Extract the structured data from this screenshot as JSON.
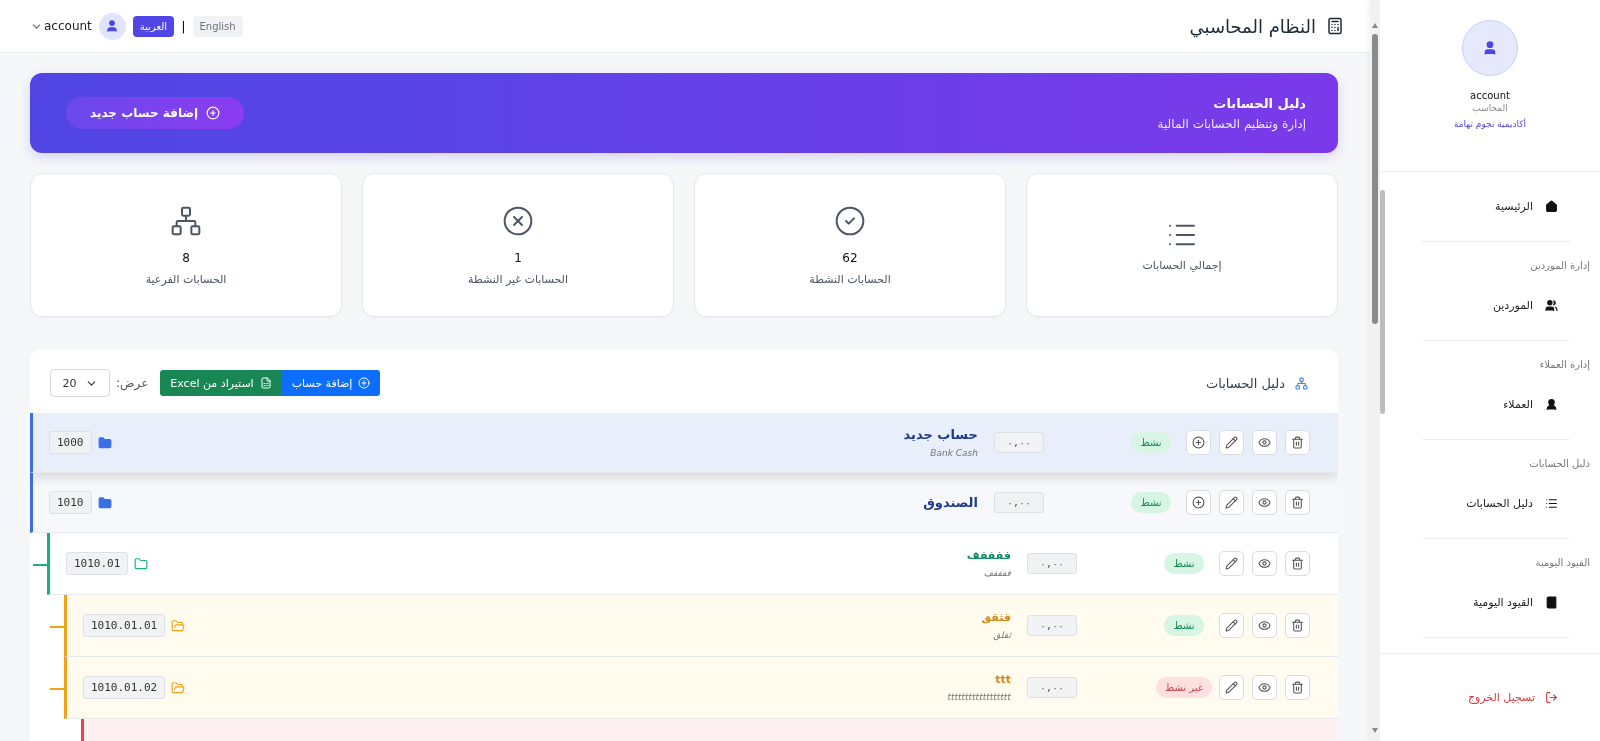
{
  "topbar": {
    "title": "النظام المحاسبي",
    "languages": [
      {
        "label": "English",
        "selected": false
      },
      {
        "label": "العربية",
        "selected": true
      }
    ],
    "separator": "|",
    "user": "account"
  },
  "banner": {
    "title": "دليل الحسابات",
    "subtitle": "إدارة وتنظيم الحسابات المالية",
    "button": "إضافة حساب جديد"
  },
  "stats": [
    {
      "label": "إجمالي الحسابات"
    },
    {
      "value": "62",
      "label": "الحسابات النشطة"
    },
    {
      "value": "1",
      "label": "الحسابات غير النشطة"
    },
    {
      "value": "8",
      "label": "الحسابات الفرعية"
    }
  ],
  "accounts_panel": {
    "title": "دليل الحسابات",
    "add_button": "إضافة حساب",
    "import_button": "استيراد من Excel",
    "page_size_label": "عرض:",
    "page_size": "20",
    "rows": [
      {
        "kind": "row",
        "code": "1000",
        "name": "حساب جديد",
        "name_en": "Bank Cash",
        "balance": "٠,٠٠",
        "status": "نشط",
        "active": true,
        "selected": true,
        "can_add": true
      },
      {
        "kind": "row",
        "code": "1010",
        "name": "الصندوق",
        "balance": "٠,٠٠",
        "status": "نشط",
        "active": true,
        "selected": false,
        "can_add": true,
        "children": [
          {
            "kind": "row",
            "code": "1010.01",
            "name": "ففففف",
            "name_en": "ففففف",
            "balance": "٠,٠٠",
            "status": "نشط",
            "active": true,
            "selected": false,
            "can_add": false,
            "children": [
              {
                "kind": "row",
                "code": "1010.01.01",
                "name": "قثقق",
                "name_en": "ثقلق",
                "balance": "٠,٠٠",
                "status": "نشط",
                "active": true,
                "selected": false,
                "can_add": false
              },
              {
                "kind": "row",
                "code": "1010.01.02",
                "name": "ttt",
                "name_en": "tttttttttttttttttt",
                "balance": "٠,٠٠",
                "status": "غير نشط",
                "active": false,
                "selected": false,
                "can_add": false,
                "children": [
                  {
                    "kind": "cut"
                  }
                ]
              }
            ]
          }
        ]
      }
    ]
  },
  "sidebar": {
    "profile": {
      "name": "account",
      "role": "المحاسب",
      "organization": "أكاديمية نجوم تهامة"
    },
    "menu": [
      {
        "label": "الرئيسية"
      },
      {
        "section": "إدارة الموردين",
        "label": "الموردين"
      },
      {
        "section": "إدارة العملاء",
        "label": "العملاء"
      },
      {
        "section": "دليل الحسابات",
        "label": "دليل الحسابات"
      },
      {
        "section": "القيود اليومية",
        "label": "القيود اليومية"
      }
    ],
    "logout": "تسجيل الخروج"
  }
}
